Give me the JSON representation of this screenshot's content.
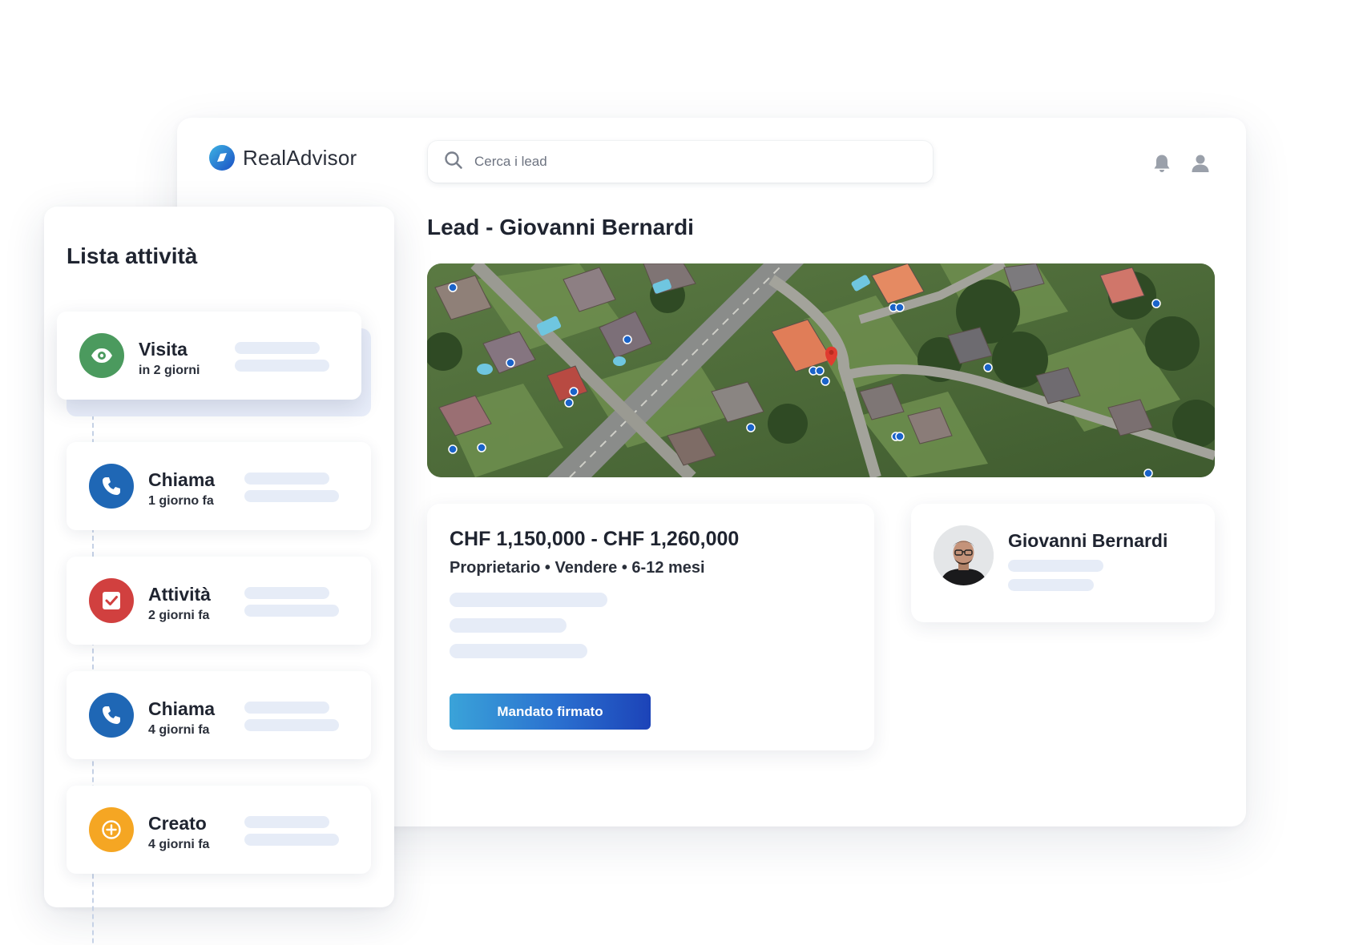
{
  "app": {
    "logo_text": "RealAdvisor",
    "search": {
      "placeholder": "Cerca i lead",
      "value": ""
    },
    "icons": [
      "bell-icon",
      "user-icon"
    ]
  },
  "lead": {
    "title": "Lead - Giovanni Bernardi",
    "price_range": "CHF 1,150,000 - CHF 1,260,000",
    "meta": "Proprietario • Vendere • 6-12 mesi",
    "mandate_button": "Mandato firmato"
  },
  "contact": {
    "name": "Giovanni Bernardi"
  },
  "activity_panel": {
    "title": "Lista attività",
    "items": [
      {
        "label": "Visita",
        "time": "in 2 giorni",
        "icon": "eye-icon",
        "color": "#4b9a5e"
      },
      {
        "label": "Chiama",
        "time": "1 giorno fa",
        "icon": "phone-icon",
        "color": "#1f67b5"
      },
      {
        "label": "Attività",
        "time": "2 giorni fa",
        "icon": "checkbox-icon",
        "color": "#d1403f"
      },
      {
        "label": "Chiama",
        "time": "4 giorni fa",
        "icon": "phone-icon",
        "color": "#1f67b5"
      },
      {
        "label": "Creato",
        "time": "4 giorni fa",
        "icon": "plus-circle-icon",
        "color": "#f5a623"
      }
    ]
  },
  "colors": {
    "brand_gradient_start": "#3aa3d9",
    "brand_gradient_end": "#1c43b8",
    "skeleton": "#e6ecf7",
    "map_pin": "#e03b2f",
    "map_marker": "#1a63c9"
  }
}
